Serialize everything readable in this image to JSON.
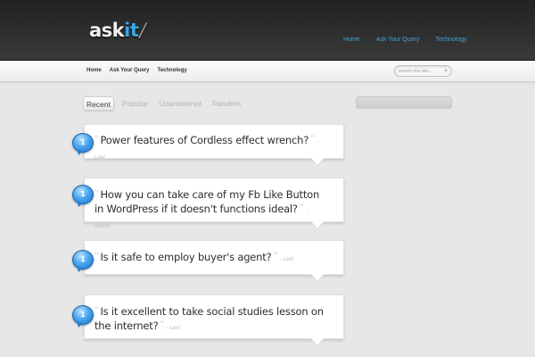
{
  "site": {
    "logo_main": "ask",
    "logo_accent": "it",
    "logo_mark": "/"
  },
  "top_nav": [
    "Home",
    "Ask Your Query",
    "Technology"
  ],
  "sub_nav": [
    "Home",
    "Ask Your Query",
    "Technology"
  ],
  "search": {
    "placeholder": "search this site...",
    "icon": "magnifier-icon"
  },
  "tabs": [
    {
      "label": "Recent",
      "active": true
    },
    {
      "label": "Popular",
      "active": false
    },
    {
      "label": "Unanswered",
      "active": false
    },
    {
      "label": "Random",
      "active": false
    }
  ],
  "questions": [
    {
      "badge": "1",
      "title": "Power features of Cordless effect wrench?",
      "author": "Lexi"
    },
    {
      "badge": "1",
      "title": "How you can take care of my Fb Like Button in WordPress if it doesn't functions ideal?",
      "author": "admin"
    },
    {
      "badge": "1",
      "title": "Is it safe to employ buyer's agent?",
      "author": "Lexi"
    },
    {
      "badge": "1",
      "title": "Is it excellent to take social studies lesson on the internet?",
      "author": "Lexi"
    }
  ],
  "colors": {
    "accent": "#3aa6e4",
    "header_bg": "#2a2a2a",
    "badge_blue": "#2a86d6"
  }
}
